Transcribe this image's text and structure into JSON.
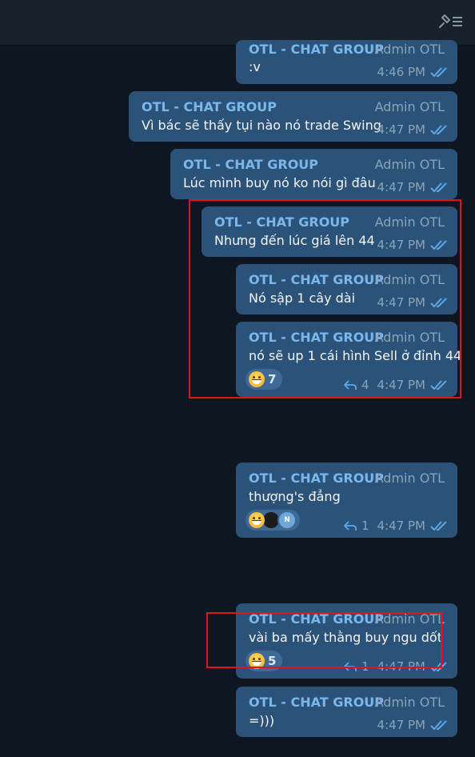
{
  "sender": "OTL - CHAT GROUP",
  "role": "Admin OTL",
  "messages": [
    {
      "text": ":v",
      "time": "4:46 PM"
    },
    {
      "text": "Vì bác sẽ thấy tụi nào nó trade Swing",
      "time": "4:47 PM"
    },
    {
      "text": "Lúc mình buy nó ko nói gì đâu",
      "time": "4:47 PM"
    },
    {
      "text": "Nhưng đến lúc giá lên 44",
      "time": "4:47 PM"
    },
    {
      "text": "Nó sập 1 cây dài",
      "time": "4:47 PM"
    },
    {
      "text": "nó sẽ up 1 cái hình Sell ở đỉnh 44",
      "time": "4:47 PM",
      "reaction_count": "7",
      "replies": "4"
    },
    {
      "text": "thượng's đẳng",
      "time": "4:47 PM",
      "reaction_avatar_letter": "N",
      "replies": "1"
    },
    {
      "text": "vài ba mấy thằng buy ngu dốt",
      "time": "4:47 PM",
      "reaction_count": "5",
      "replies": "1"
    },
    {
      "text": "=)))",
      "time": "4:47 PM"
    }
  ],
  "colors": {
    "background": "#0e1621",
    "bubble": "#2b5278",
    "sender": "#7cb7ec",
    "highlight": "#e0151b"
  }
}
